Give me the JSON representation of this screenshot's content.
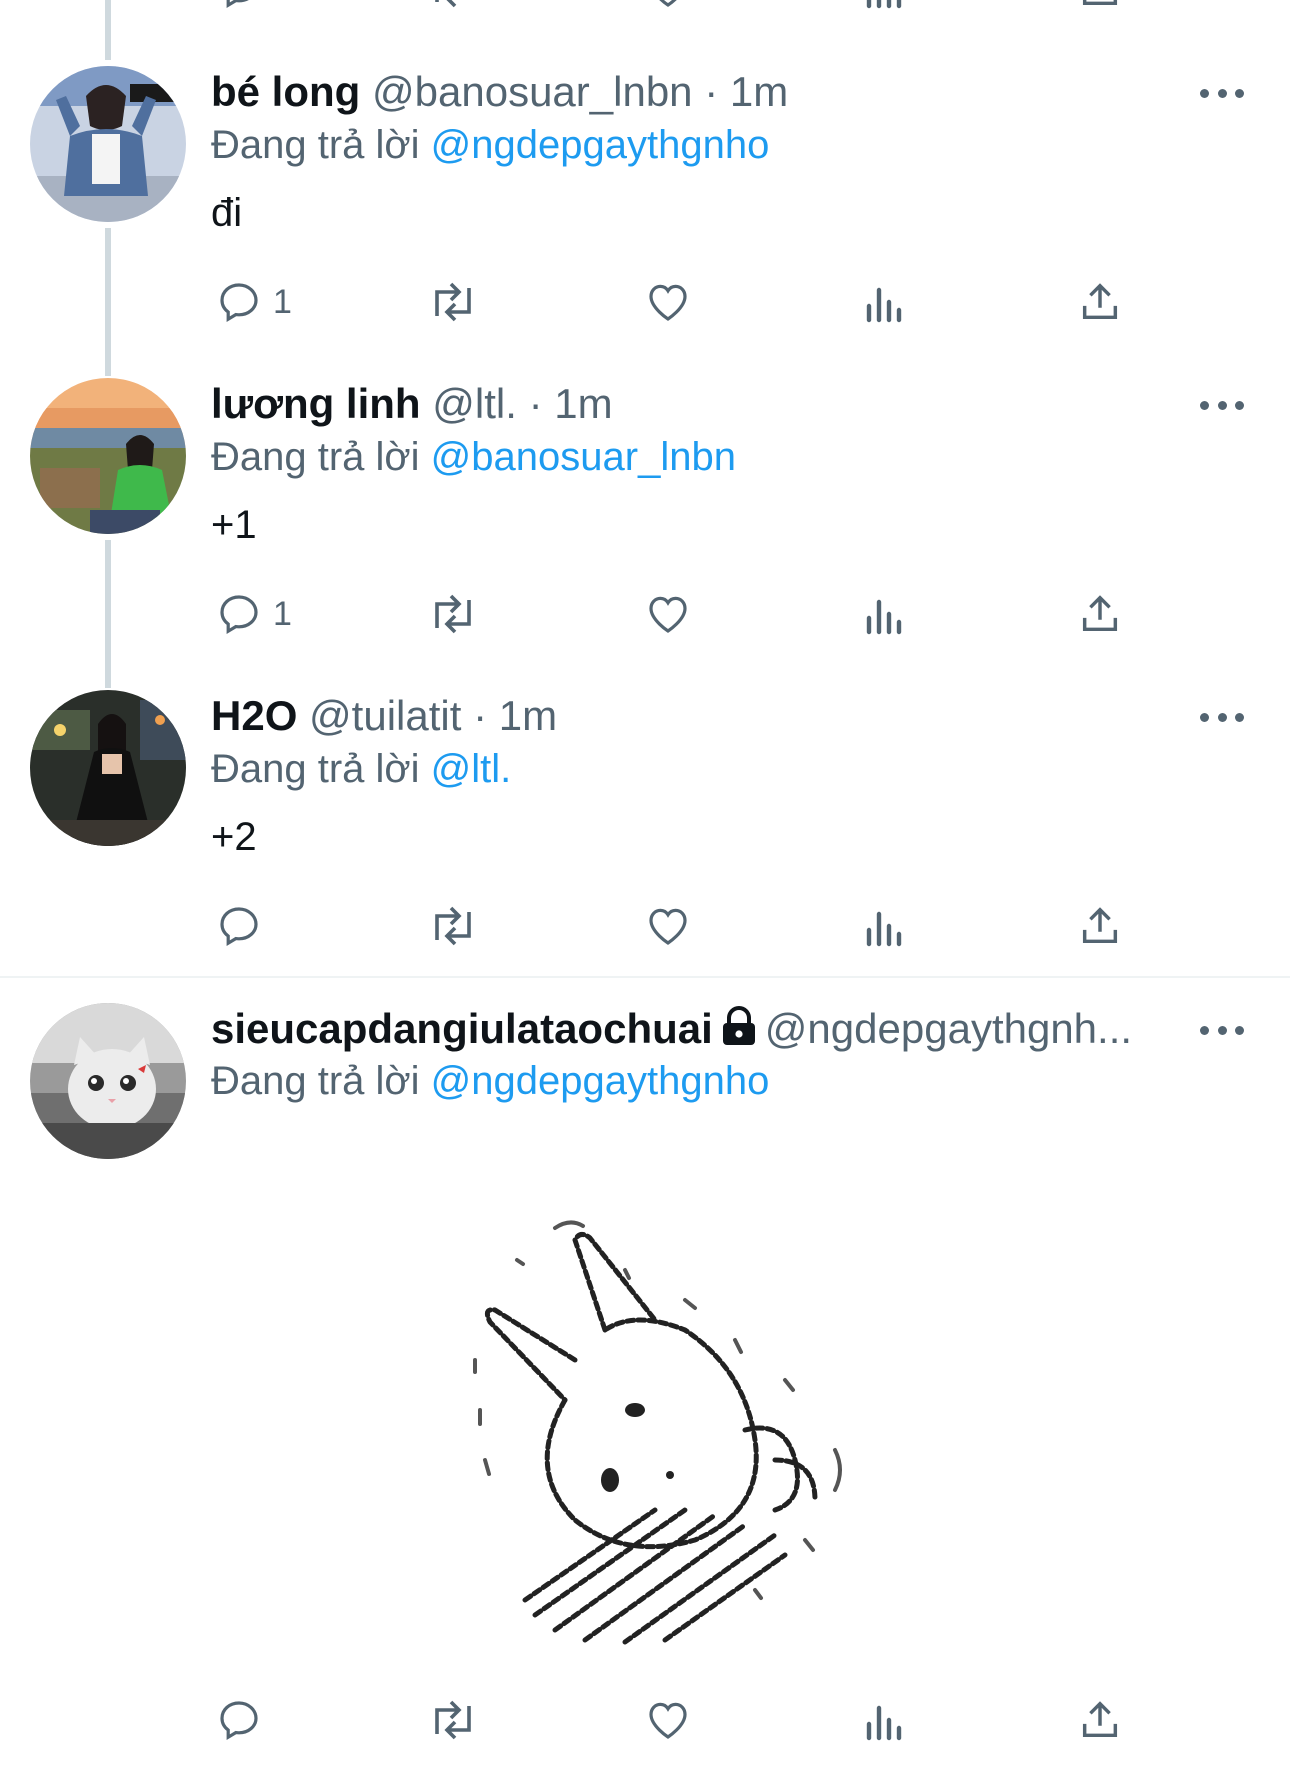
{
  "colors": {
    "link": "#1d9bf0",
    "secondary_text": "#536471",
    "primary_text": "#0f1419",
    "thread_line": "#cfd9de"
  },
  "replies": [
    {
      "display_name": "bé long",
      "handle": "@banosuar_lnbn",
      "dot": "·",
      "time": "1m",
      "reply_prefix": "Đang trả lời",
      "reply_to": "@ngdepgaythgnho",
      "text": "đi",
      "reply_count": "1",
      "avatar_icon": "avatar-photo"
    },
    {
      "display_name": "lương linh",
      "handle": "@ltl.",
      "dot": "·",
      "time": "1m",
      "reply_prefix": "Đang trả lời",
      "reply_to": "@banosuar_lnbn",
      "text": "+1",
      "reply_count": "1",
      "avatar_icon": "avatar-photo"
    },
    {
      "display_name": "H2O",
      "handle": "@tuilatit",
      "dot": "·",
      "time": "1m",
      "reply_prefix": "Đang trả lời",
      "reply_to": "@ltl.",
      "text": "+2",
      "reply_count": "",
      "avatar_icon": "avatar-photo"
    },
    {
      "display_name": "sieucapdangiulataochuai",
      "handle": "@ngdepgaythgnh...",
      "reply_prefix": "Đang trả lời",
      "reply_to": "@ngdepgaythgnho",
      "reply_count": "",
      "avatar_icon": "cat-avatar",
      "media": "bunny-sketch-sticker"
    }
  ],
  "icons": {
    "reply": "reply-bubble-icon",
    "retweet": "retweet-icon",
    "like": "heart-icon",
    "views": "bar-chart-icon",
    "share": "share-upload-icon",
    "more": "more-dots-icon",
    "protected": "lock-icon"
  }
}
